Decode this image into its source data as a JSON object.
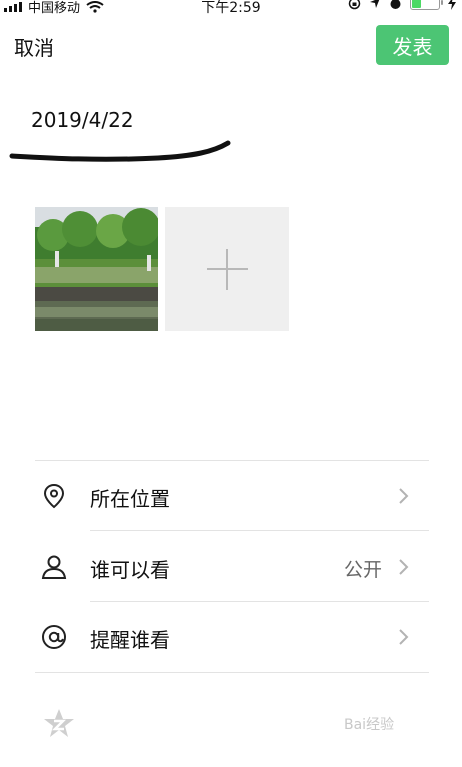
{
  "status_bar": {
    "carrier": "中国移动",
    "time": "下午2:59"
  },
  "header": {
    "cancel_label": "取消",
    "publish_label": "发表"
  },
  "post": {
    "text": "2019/4/22"
  },
  "options": [
    {
      "label": "所在位置",
      "value": "",
      "icon": "location-pin-icon"
    },
    {
      "label": "谁可以看",
      "value": "公开",
      "icon": "person-icon"
    },
    {
      "label": "提醒谁看",
      "value": "",
      "icon": "at-sign-icon"
    }
  ],
  "watermark": "Bai经验",
  "colors": {
    "accent": "#4cc574",
    "battery": "#4cd964",
    "add_tile": "#efefef"
  }
}
